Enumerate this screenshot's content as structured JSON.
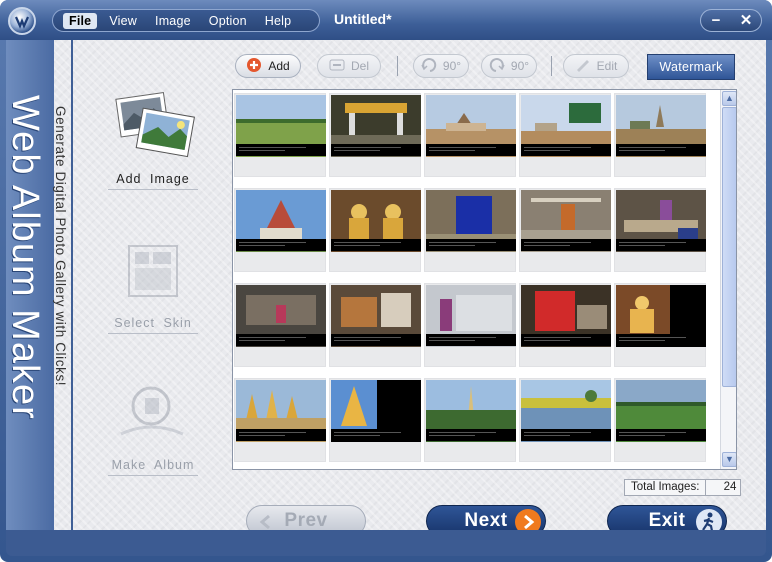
{
  "window": {
    "menu": [
      "File",
      "View",
      "Image",
      "Option",
      "Help"
    ],
    "title": "Untitled*",
    "minimize_label": "−",
    "close_label": "✕"
  },
  "brand": {
    "name": "Web Album Maker",
    "tagline": "Generate Digital Photo Gallery with Clicks!"
  },
  "steps": [
    {
      "label": "Add  Image",
      "state": "active",
      "icon": "add-image-icon"
    },
    {
      "label": "Select  Skin",
      "state": "disabled",
      "icon": "select-skin-icon"
    },
    {
      "label": "Make  Album",
      "state": "disabled",
      "icon": "make-album-icon"
    }
  ],
  "toolbar": {
    "add": "Add",
    "del": "Del",
    "rotate_left": "90°",
    "rotate_right": "90°",
    "edit": "Edit",
    "watermark": "Watermark"
  },
  "gallery": {
    "thumbnails": [
      {
        "scene": "field"
      },
      {
        "scene": "gate"
      },
      {
        "scene": "temple"
      },
      {
        "scene": "sign"
      },
      {
        "scene": "pagodas"
      },
      {
        "scene": "monastery"
      },
      {
        "scene": "buddha"
      },
      {
        "scene": "loom-blue"
      },
      {
        "scene": "looms"
      },
      {
        "scene": "weaver"
      },
      {
        "scene": "weaving-room"
      },
      {
        "scene": "workshop"
      },
      {
        "scene": "person"
      },
      {
        "scene": "red-loom"
      },
      {
        "scene": "buddha-gold"
      },
      {
        "scene": "golden-stupas"
      },
      {
        "scene": "golden-pagoda"
      },
      {
        "scene": "spire"
      },
      {
        "scene": "lake"
      },
      {
        "scene": "plain"
      }
    ],
    "caption_color": "#000000"
  },
  "status": {
    "total_label": "Total Images:",
    "total_value": "24"
  },
  "nav": {
    "prev": "Prev",
    "next": "Next",
    "exit": "Exit"
  },
  "colors": {
    "frame": "#3d5f98",
    "accent": "#2f5597",
    "next_arrow": "#f07a1e"
  }
}
